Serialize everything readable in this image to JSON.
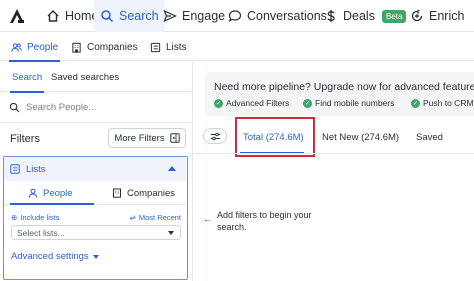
{
  "nav": {
    "items": [
      {
        "label": "Home",
        "icon": "home-icon"
      },
      {
        "label": "Search",
        "icon": "search-icon",
        "active": true
      },
      {
        "label": "Engage",
        "icon": "send-icon"
      },
      {
        "label": "Conversations",
        "icon": "chat-icon"
      },
      {
        "label": "Deals",
        "icon": "dollar-icon",
        "badge": "Beta"
      },
      {
        "label": "Enrich",
        "icon": "enrich-icon"
      }
    ]
  },
  "subnav": {
    "people": "People",
    "companies": "Companies",
    "lists": "Lists"
  },
  "left": {
    "tabs": {
      "search": "Search",
      "saved": "Saved searches"
    },
    "search_placeholder": "Search People...",
    "filters_title": "Filters",
    "more_filters": "More Filters",
    "lists_section": {
      "title": "Lists",
      "people_tab": "People",
      "companies_tab": "Companies",
      "include_label": "Include lists",
      "sort_label": "Most Recent",
      "select_placeholder": "Select lists...",
      "advanced": "Advanced settings"
    }
  },
  "banner": {
    "title": "Need more pipeline? Upgrade now for advanced features",
    "features": [
      "Advanced Filters",
      "Find mobile numbers",
      "Push to CRM"
    ]
  },
  "results": {
    "tabs": [
      {
        "label": "Total (274.6M)",
        "active": true
      },
      {
        "label": "Net New (274.6M)"
      },
      {
        "label": "Saved"
      }
    ],
    "empty_arrow": "←",
    "empty_message": "Add filters to begin your search."
  },
  "colors": {
    "accent": "#2a62d4",
    "highlight": "#d7283a",
    "success": "#3fa56b"
  }
}
